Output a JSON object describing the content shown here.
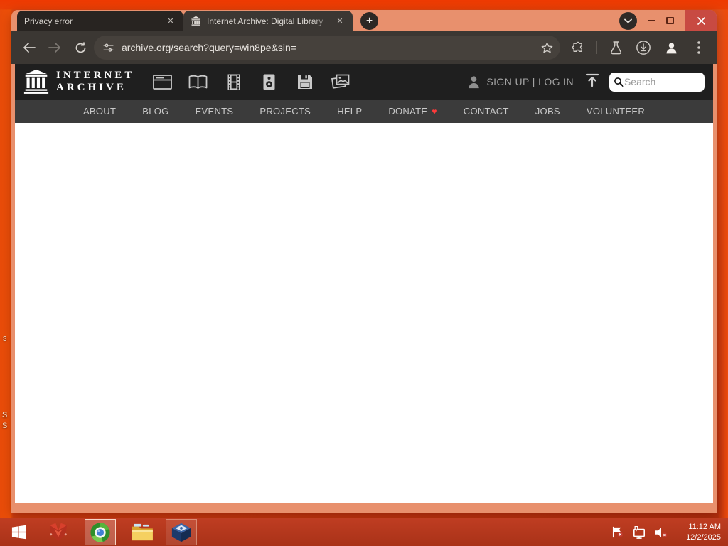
{
  "icons": {
    "close_glyph": "✕",
    "plus_glyph": "+",
    "heart_glyph": "♥"
  },
  "browser": {
    "tabs": [
      {
        "title": "Privacy error"
      },
      {
        "title": "Internet Archive: Digital Library"
      }
    ],
    "url": "archive.org/search?query=win8pe&sin="
  },
  "site": {
    "logo_line1": "INTERNET",
    "logo_line2": "ARCHIVE",
    "auth": {
      "signup": "SIGN UP",
      "divider": "|",
      "login": "LOG IN"
    },
    "search_placeholder": "Search",
    "nav": [
      "ABOUT",
      "BLOG",
      "EVENTS",
      "PROJECTS",
      "HELP",
      "DONATE",
      "CONTACT",
      "JOBS",
      "VOLUNTEER"
    ]
  },
  "taskbar": {
    "clock_time": "11:12 AM",
    "clock_date": "12/2/2025"
  },
  "desktop": {
    "label_fragments": [
      "s",
      "S",
      "S"
    ]
  },
  "colors": {
    "frame": "#e8906d",
    "toolbar": "#3b3733",
    "ia_header": "#1f1f1f",
    "ia_nav": "#3b3b3b",
    "taskbar": "#b23418",
    "desktop": "#d9441a",
    "close_button": "#c84a42",
    "heart": "#ff3a3a"
  }
}
